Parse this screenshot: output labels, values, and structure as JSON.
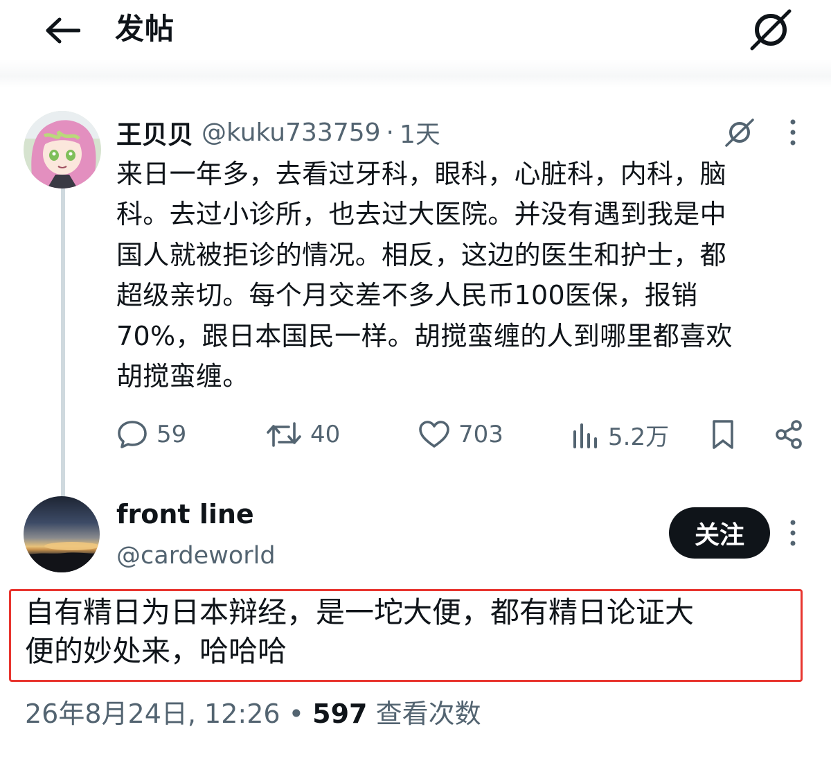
{
  "header": {
    "back_icon": "arrow-left-icon",
    "title": "发帖",
    "grok_icon": "grok-slash-icon"
  },
  "post": {
    "author_name": "王贝贝",
    "author_handle": "@kuku733759",
    "separator": "·",
    "time": "1天",
    "body_lines": [
      "来日一年多，去看过牙科，眼科，心脏科，内科，脑",
      "科。去过小诊所，也去过大医院。并没有遇到我是中",
      "国人就被拒诊的情况。相反，这边的医生和护士，都",
      "超级亲切。每个月交差不多人民币100医保，报销",
      "70%，跟日本国民一样。胡搅蛮缠的人到哪里都喜欢",
      "胡搅蛮缠。"
    ],
    "actions": {
      "replies": "59",
      "reposts": "40",
      "likes": "703",
      "views": "5.2万"
    }
  },
  "reply": {
    "author_name": "front line",
    "author_handle": "@cardeworld",
    "follow_label": "关注",
    "body_lines": [
      "自有精日为日本辩经，是一坨大便，都有精日论证大",
      "便的妙处来，哈哈哈"
    ],
    "timestamp": "26年8月24日, 12:26",
    "separator": "•",
    "views_count": "597",
    "views_label": "查看次数"
  },
  "colors": {
    "text_primary": "#0f1419",
    "text_secondary": "#536471",
    "thread_line": "#cfd9de",
    "highlight_border": "#e8352f",
    "follow_button_bg": "#0f1419"
  }
}
